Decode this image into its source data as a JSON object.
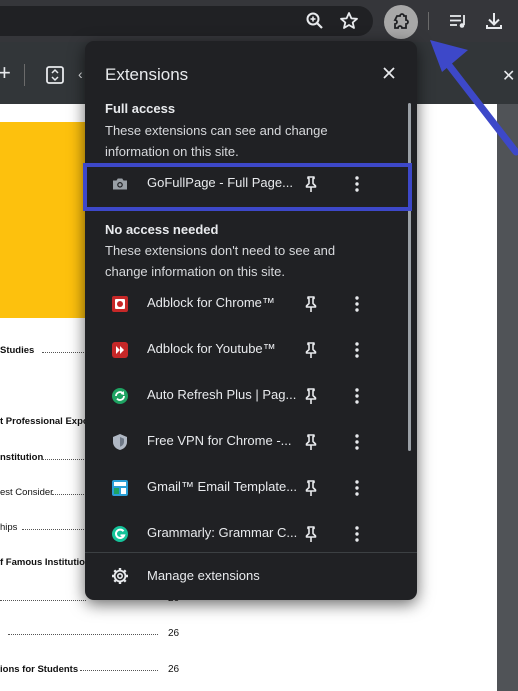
{
  "panel": {
    "title": "Extensions",
    "full_access": {
      "heading": "Full access",
      "description": "These extensions can see and change information on this site.",
      "items": [
        {
          "label": "GoFullPage - Full Page...",
          "icon": "camera-icon"
        }
      ]
    },
    "no_access": {
      "heading": "No access needed",
      "description": "These extensions don't need to see and change information on this site.",
      "items": [
        {
          "label": "Adblock for Chrome™",
          "icon": "adblock-chrome-icon",
          "color": "#c62828"
        },
        {
          "label": "Adblock for Youtube™",
          "icon": "adblock-youtube-icon",
          "color": "#c62828"
        },
        {
          "label": "Auto Refresh Plus | Pag...",
          "icon": "auto-refresh-icon",
          "color": "#1ea362"
        },
        {
          "label": "Free VPN for Chrome -...",
          "icon": "vpn-shield-icon",
          "color": "#b0b8c4"
        },
        {
          "label": "Gmail™ Email Template...",
          "icon": "gmail-template-icon",
          "color": "#2a9fd6"
        },
        {
          "label": "Grammarly: Grammar C...",
          "icon": "grammarly-icon",
          "color": "#15c39a"
        }
      ]
    },
    "manage_label": "Manage extensions"
  },
  "document": {
    "toc": [
      {
        "text": "Studies"
      },
      {
        "text": "t Professional Expo"
      },
      {
        "text": "nstitution"
      },
      {
        "text": "est Consider"
      },
      {
        "text": "hips"
      },
      {
        "text": "f Famous Institutio"
      },
      {
        "text": ""
      },
      {
        "text": "ions for Students"
      }
    ],
    "page_numbers": [
      "26",
      "26",
      "26"
    ]
  },
  "colors": {
    "panel_bg": "#202124",
    "highlight": "#3d48c9",
    "arrow": "#3d48c9",
    "accent_yellow": "#fdc10d"
  }
}
